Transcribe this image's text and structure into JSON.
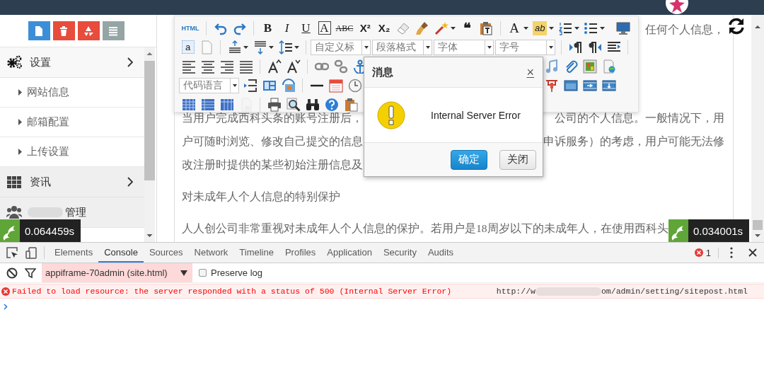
{
  "sidebar": {
    "buttons": [
      {
        "color": "#3b8fd9"
      },
      {
        "color": "#e74c3c"
      },
      {
        "color": "#e74c3c"
      },
      {
        "color": "#95a5a6"
      }
    ],
    "menu": [
      {
        "label": "设置",
        "expanded": true,
        "submenu": true,
        "redacted": false,
        "children": [
          {
            "label": "网站信息"
          },
          {
            "label": "邮箱配置"
          },
          {
            "label": "上传设置"
          }
        ]
      },
      {
        "label": "资讯",
        "expanded": false,
        "submenu": true,
        "redacted": false
      },
      {
        "label": "管理",
        "expanded": false,
        "submenu": false,
        "redacted": true
      }
    ],
    "timer": "0.064459s"
  },
  "editor": {
    "toolbar": {
      "rows": [
        {
          "items": [
            {
              "kind": "glyph",
              "text": "HTML",
              "disabled": false
            },
            {
              "kind": "separator"
            },
            {
              "kind": "icon",
              "disabled": false
            },
            {
              "kind": "icon",
              "disabled": false
            },
            {
              "kind": "separator"
            },
            {
              "kind": "glyph",
              "text": "B",
              "disabled": false
            },
            {
              "kind": "glyph",
              "text": "I",
              "disabled": false
            },
            {
              "kind": "glyph",
              "text": "U",
              "disabled": false
            },
            {
              "kind": "glyph",
              "text": "A",
              "disabled": false
            },
            {
              "kind": "glyph",
              "text": "ABC",
              "disabled": false
            },
            {
              "kind": "glyph",
              "text": "X²",
              "disabled": false
            },
            {
              "kind": "glyph",
              "text": "X₂",
              "disabled": false
            },
            {
              "kind": "icon",
              "disabled": false
            },
            {
              "kind": "icon",
              "disabled": false
            },
            {
              "kind": "icon",
              "disabled": false
            },
            {
              "kind": "caret"
            },
            {
              "kind": "glyph",
              "text": "❝",
              "disabled": false
            },
            {
              "kind": "icon",
              "disabled": false
            },
            {
              "kind": "separator"
            },
            {
              "kind": "glyph",
              "text": "A",
              "disabled": false
            },
            {
              "kind": "caret"
            },
            {
              "kind": "glyph",
              "text": "ab",
              "disabled": false
            },
            {
              "kind": "caret"
            },
            {
              "kind": "icon",
              "disabled": false
            },
            {
              "kind": "caret"
            },
            {
              "kind": "icon",
              "disabled": false
            },
            {
              "kind": "caret"
            }
          ],
          "trailing": [
            {
              "kind": "icon",
              "disabled": false
            }
          ]
        },
        {
          "items": [
            {
              "kind": "glyph",
              "text": "a",
              "disabled": false
            },
            {
              "kind": "icon",
              "disabled": false
            },
            {
              "kind": "separator"
            },
            {
              "kind": "icon",
              "disabled": false
            },
            {
              "kind": "caret"
            },
            {
              "kind": "icon",
              "disabled": false
            },
            {
              "kind": "caret"
            },
            {
              "kind": "icon",
              "disabled": false
            },
            {
              "kind": "caret"
            },
            {
              "kind": "separator"
            },
            {
              "kind": "select",
              "value": "自定义标"
            },
            {
              "kind": "select",
              "value": "段落格式"
            },
            {
              "kind": "select",
              "value": "字体"
            },
            {
              "kind": "select",
              "value": "字号"
            },
            {
              "kind": "separator"
            },
            {
              "kind": "icon",
              "disabled": false
            },
            {
              "kind": "icon",
              "disabled": false
            },
            {
              "kind": "icon",
              "disabled": false
            },
            {
              "kind": "separator"
            }
          ]
        },
        {
          "items": [
            {
              "kind": "icon",
              "disabled": false
            },
            {
              "kind": "icon",
              "disabled": false
            },
            {
              "kind": "icon",
              "disabled": false
            },
            {
              "kind": "icon",
              "disabled": false
            },
            {
              "kind": "separator"
            },
            {
              "kind": "icon",
              "disabled": false
            },
            {
              "kind": "icon",
              "disabled": false
            },
            {
              "kind": "separator"
            },
            {
              "kind": "icon",
              "disabled": false
            },
            {
              "kind": "icon",
              "disabled": false
            },
            {
              "kind": "icon",
              "disabled": false
            }
          ],
          "trailing": [
            {
              "kind": "icon",
              "disabled": false
            },
            {
              "kind": "icon",
              "disabled": false
            },
            {
              "kind": "icon",
              "disabled": false
            },
            {
              "kind": "icon",
              "disabled": false
            }
          ]
        },
        {
          "items": [
            {
              "kind": "select",
              "value": "代码语言"
            },
            {
              "kind": "icon",
              "disabled": false
            },
            {
              "kind": "icon",
              "disabled": false
            },
            {
              "kind": "icon",
              "disabled": false
            },
            {
              "kind": "separator"
            },
            {
              "kind": "icon",
              "disabled": false
            },
            {
              "kind": "icon",
              "disabled": false
            },
            {
              "kind": "icon",
              "disabled": false
            }
          ],
          "trailing": [
            {
              "kind": "icon",
              "disabled": false
            },
            {
              "kind": "icon",
              "disabled": false
            },
            {
              "kind": "icon",
              "disabled": false
            },
            {
              "kind": "icon",
              "disabled": false
            }
          ]
        },
        {
          "items": [
            {
              "kind": "icon",
              "disabled": false
            },
            {
              "kind": "icon",
              "disabled": false
            },
            {
              "kind": "icon",
              "disabled": false
            },
            {
              "kind": "icon",
              "disabled": true
            },
            {
              "kind": "separator"
            },
            {
              "kind": "icon",
              "disabled": false
            },
            {
              "kind": "icon",
              "disabled": false
            },
            {
              "kind": "icon",
              "disabled": false
            },
            {
              "kind": "icon",
              "disabled": false
            },
            {
              "kind": "icon",
              "disabled": false
            }
          ]
        }
      ]
    },
    "paragraphs": [
      {
        "lines": [
          {
            "right": "任何个人信息，"
          }
        ]
      },
      {
        "lines": [
          {
            "left": "当用户完成西科头条的账号注册后，",
            "right": "公司的个人信息。一般情况下，用"
          },
          {
            "left": "户可随时浏览、修改自己提交的信息",
            "right": "申诉服务）的考虑，用户可能无法修"
          },
          {
            "left": "改注册时提供的某些初始注册信息及"
          }
        ]
      },
      {
        "lines": [
          {
            "left": "对未成年人个人信息的特别保护"
          }
        ]
      },
      {
        "lines": [
          {
            "left": "人人创公司非常重视对未成年人个人信息的保护。若用户是18周岁以下的未成年人，在使用西科头"
          }
        ]
      }
    ],
    "timer": "0.034001s"
  },
  "dialog": {
    "title": "消息",
    "close": "×",
    "message": "Internal Server Error",
    "buttons": [
      {
        "label": "确定",
        "kind": "primary"
      },
      {
        "label": "关闭",
        "kind": "default"
      }
    ]
  },
  "devtools": {
    "tabs": [
      {
        "label": "Elements",
        "selected": false
      },
      {
        "label": "Console",
        "selected": true
      },
      {
        "label": "Sources",
        "selected": false
      },
      {
        "label": "Network",
        "selected": false
      },
      {
        "label": "Timeline",
        "selected": false
      },
      {
        "label": "Profiles",
        "selected": false
      },
      {
        "label": "Application",
        "selected": false
      },
      {
        "label": "Security",
        "selected": false
      },
      {
        "label": "Audits",
        "selected": false
      }
    ],
    "error_count": "1",
    "context": "appiframe-70admin (site.html)",
    "preserve_log": {
      "label": "Preserve log",
      "checked": false
    },
    "messages": [
      {
        "kind": "error",
        "text": "Failed to load resource: the server responded with a status of 500 (Internal Server Error)",
        "source_start": "http://w",
        "source_end": "om/admin/setting/sitepost.html"
      }
    ]
  }
}
